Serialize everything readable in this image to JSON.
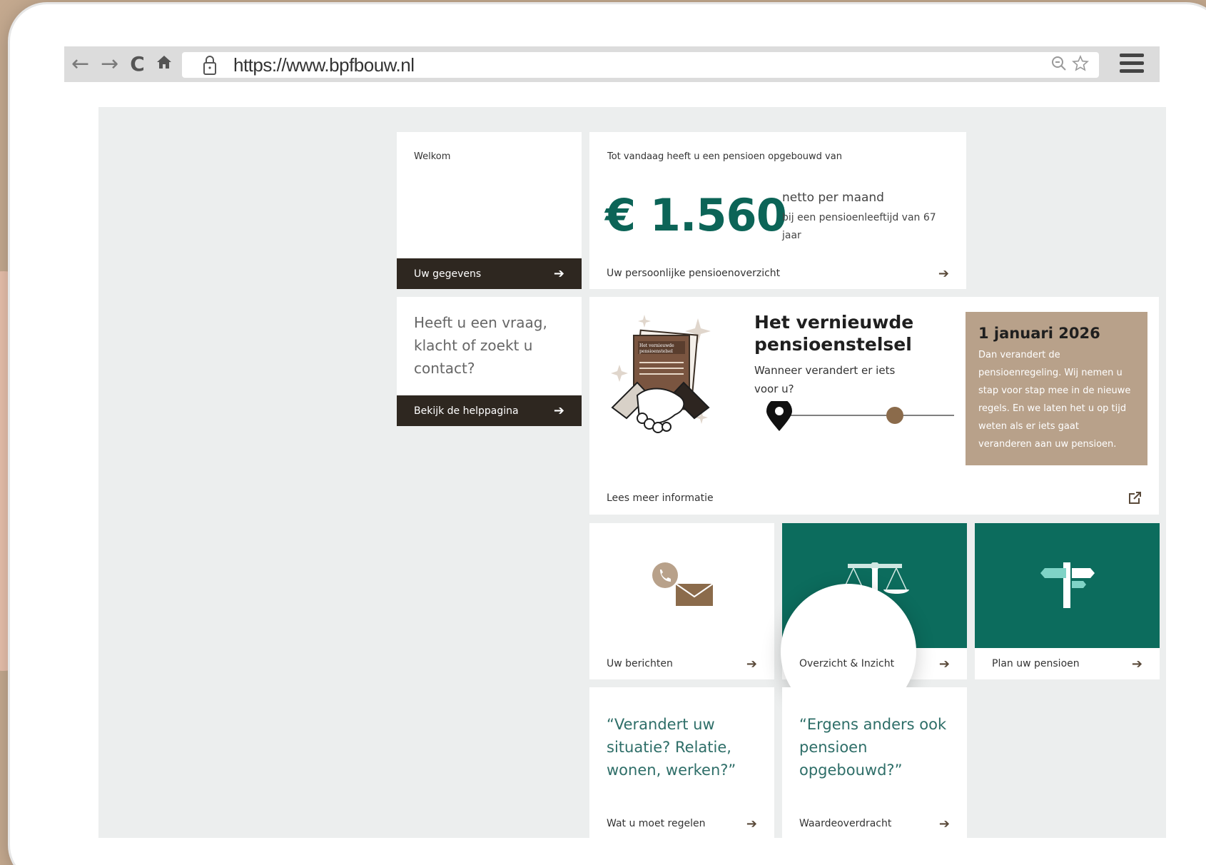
{
  "browser": {
    "url": "https://www.bpfbouw.nl",
    "back_icon": "←",
    "forward_icon": "→",
    "reload_icon": "C",
    "home_icon": "⌂"
  },
  "welcome": {
    "title": "Welkom",
    "button": "Uw gegevens"
  },
  "pension": {
    "intro": "Tot vandaag heeft u een pensioen opgebouwd van",
    "amount": "€ 1.560",
    "per_month": "netto per maand",
    "age_note": "bij een pensioenleeftijd van 67 jaar",
    "link": "Uw persoonlijke pensioenoverzicht"
  },
  "help": {
    "question": "Heeft u een vraag, klacht of zoekt u contact?",
    "button": "Bekijk de helppagina"
  },
  "reform": {
    "title": "Het vernieuwde pensioenstelsel",
    "subtitle": "Wanneer verandert er iets voor u?",
    "box_title": "1 januari 2026",
    "box_text": "Dan verandert de pensioenregeling. Wij nemen u stap voor stap mee in de nieuwe regels. En we laten het u op tijd weten als er iets gaat veranderen aan uw pensioen.",
    "link": "Lees meer informatie",
    "doc_title": "Het vernieuwde pensioenstelsel"
  },
  "tiles": [
    {
      "label": "Uw berichten",
      "icon": "phone-mail-icon"
    },
    {
      "label": "Overzicht & Inzicht",
      "icon": "scales-icon"
    },
    {
      "label": "Plan uw pensioen",
      "icon": "signpost-icon"
    }
  ],
  "quotes": [
    {
      "text": "“Verandert uw situatie? Relatie, wonen, werken?”",
      "link": "Wat u moet regelen"
    },
    {
      "text": "“Ergens anders ook pensioen opgebouwd?”",
      "link": "Waardeoverdracht"
    }
  ],
  "colors": {
    "teal": "#0c6c5d",
    "brown": "#2e2720",
    "tan": "#b8a18a"
  }
}
